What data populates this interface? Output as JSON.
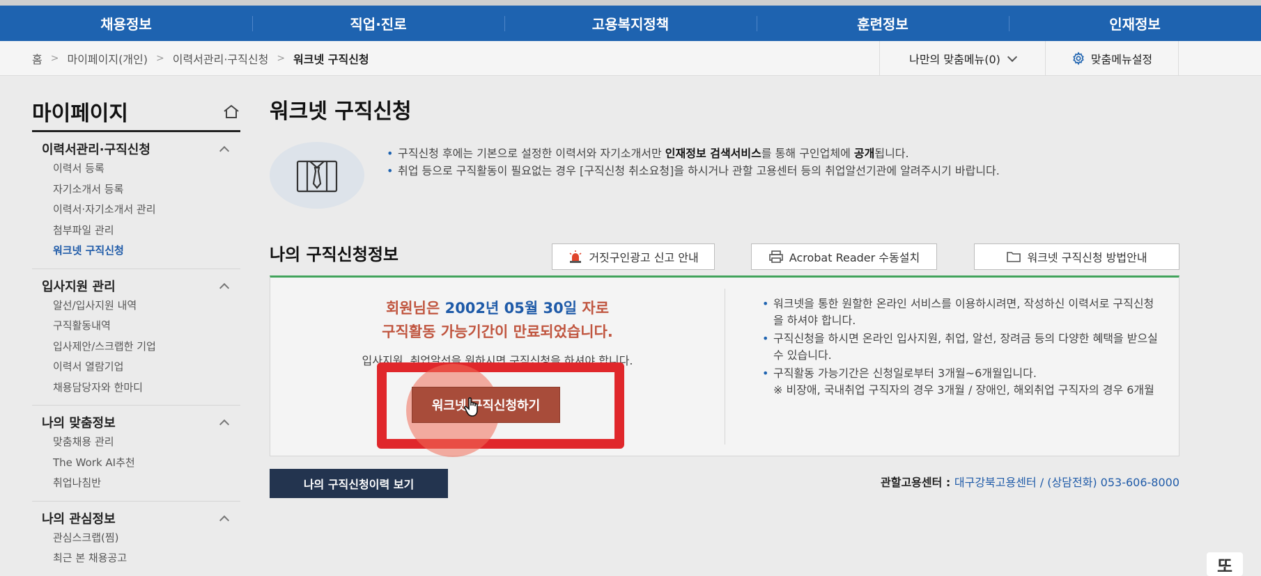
{
  "gnb": {
    "items": [
      "채용정보",
      "직업·진로",
      "고용복지정책",
      "훈련정보",
      "인재정보"
    ]
  },
  "breadcrumb": {
    "items": [
      "홈",
      "마이페이지(개인)",
      "이력서관리·구직신청"
    ],
    "current": "워크넷 구직신청",
    "separator": ">"
  },
  "subbar": {
    "my_menu": "나만의 맞춤메뉴(0)",
    "settings": "맞춤메뉴설정"
  },
  "sidebar": {
    "title": "마이페이지",
    "groups": [
      {
        "title": "이력서관리·구직신청",
        "items": [
          "이력서 등록",
          "자기소개서 등록",
          "이력서·자기소개서 관리",
          "첨부파일 관리",
          "워크넷 구직신청"
        ],
        "active_index": 4
      },
      {
        "title": "입사지원 관리",
        "items": [
          "알선/입사지원 내역",
          "구직활동내역",
          "입사제안/스크랩한 기업",
          "이력서 열람기업",
          "채용담당자와 한마디"
        ]
      },
      {
        "title": "나의 맞춤정보",
        "items": [
          "맞춤채용 관리",
          "The Work AI추천",
          "취업나침반"
        ]
      },
      {
        "title": "나의 관심정보",
        "items": [
          "관심스크랩(찜)",
          "최근 본 채용공고"
        ]
      }
    ]
  },
  "main": {
    "title": "워크넷 구직신청",
    "intro": {
      "line1_pre": "구직신청 후에는 기본으로 설정한 이력서와 자기소개서만 ",
      "line1_bold1": "인재정보 검색서비스",
      "line1_mid": "를 통해 구인업체에 ",
      "line1_bold2": "공개",
      "line1_post": "됩니다.",
      "line2": "취업 등으로 구직활동이 필요없는 경우 [구직신청 취소요청]을 하시거나 관할 고용센터 등의 취업알선기관에 알려주시기 바랍니다."
    },
    "section_title": "나의 구직신청정보",
    "buttons": {
      "fake_ad": "거짓구인광고 신고 안내",
      "acrobat": "Acrobat Reader 수동설치",
      "guide": "워크넷 구직신청 방법안내"
    },
    "status": {
      "msg_pre": "회원님은 ",
      "date": "2002년 05월 30일",
      "msg_post": " 자로",
      "msg2": "구직활동 가능기간이 만료되었습니다.",
      "msg3": "입사지원, 취업알선을 원하시면 구직신청을 하셔야 합니다.",
      "apply_button": "워크넷 구직신청하기"
    },
    "notes": [
      "워크넷을 통한 원할한 온라인 서비스를 이용하시려면, 작성하신 이력서로 구직신청을 하셔야 합니다.",
      "구직신청을 하시면 온라인 입사지원, 취업, 알선, 장려금 등의 다양한 혜택을 받으실 수 있습니다.",
      "구직활동 가능기간은 신청일로부터 3개월~6개월입니다.",
      "※ 비장애, 국내취업 구직자의 경우 3개월 / 장애인, 해외취업 구직자의 경우 6개월"
    ],
    "history_button": "나의 구직신청이력 보기",
    "center": {
      "label": "관할고용센터 : ",
      "name": "대구강북고용센터",
      "phone_label": " / (상담전화) ",
      "phone": "053-606-8000"
    }
  },
  "watermark": "또",
  "colors": {
    "gnb": "#1e63b0",
    "accent_green": "#41a35b",
    "warning_text": "#c0553f",
    "apply_button": "#a84c3a",
    "highlight_box": "#e0272b",
    "history_button": "#23344f"
  }
}
